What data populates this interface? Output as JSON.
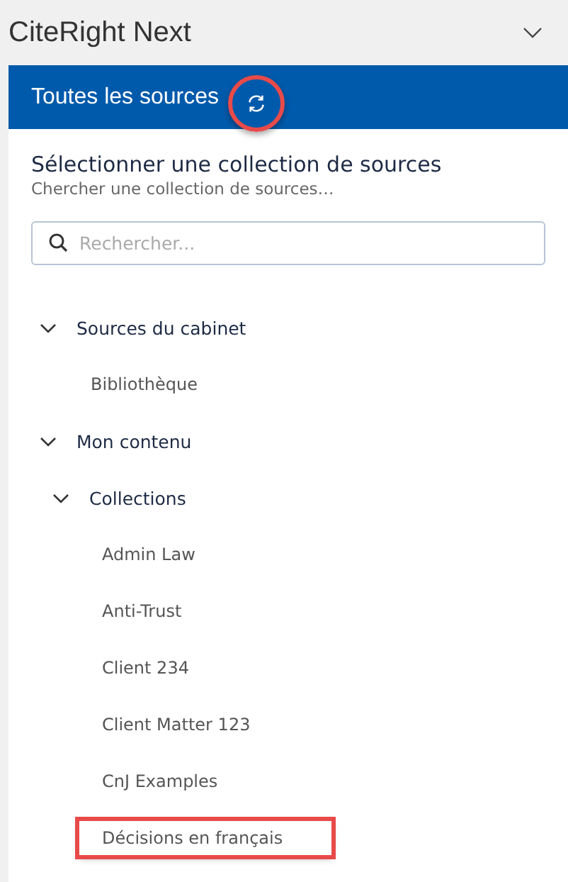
{
  "pane": {
    "title": "CiteRight Next"
  },
  "header": {
    "title": "Toutes les sources",
    "refresh_highlighted": true
  },
  "section": {
    "title": "Sélectionner une collection de sources",
    "subtitle": "Chercher une collection de sources…"
  },
  "search": {
    "placeholder": "Rechercher..."
  },
  "tree": [
    {
      "label": "Sources du cabinet",
      "expanded": true,
      "children": [
        {
          "label": "Bibliothèque",
          "highlighted": false
        }
      ]
    },
    {
      "label": "Mon contenu",
      "expanded": true,
      "children": [
        {
          "label": "Collections",
          "expanded": true,
          "children": [
            {
              "label": "Admin Law",
              "highlighted": false
            },
            {
              "label": "Anti-Trust",
              "highlighted": false
            },
            {
              "label": "Client 234",
              "highlighted": false
            },
            {
              "label": "Client Matter 123",
              "highlighted": false
            },
            {
              "label": "CnJ Examples",
              "highlighted": false
            },
            {
              "label": "Décisions en français",
              "highlighted": true
            }
          ]
        }
      ]
    }
  ]
}
